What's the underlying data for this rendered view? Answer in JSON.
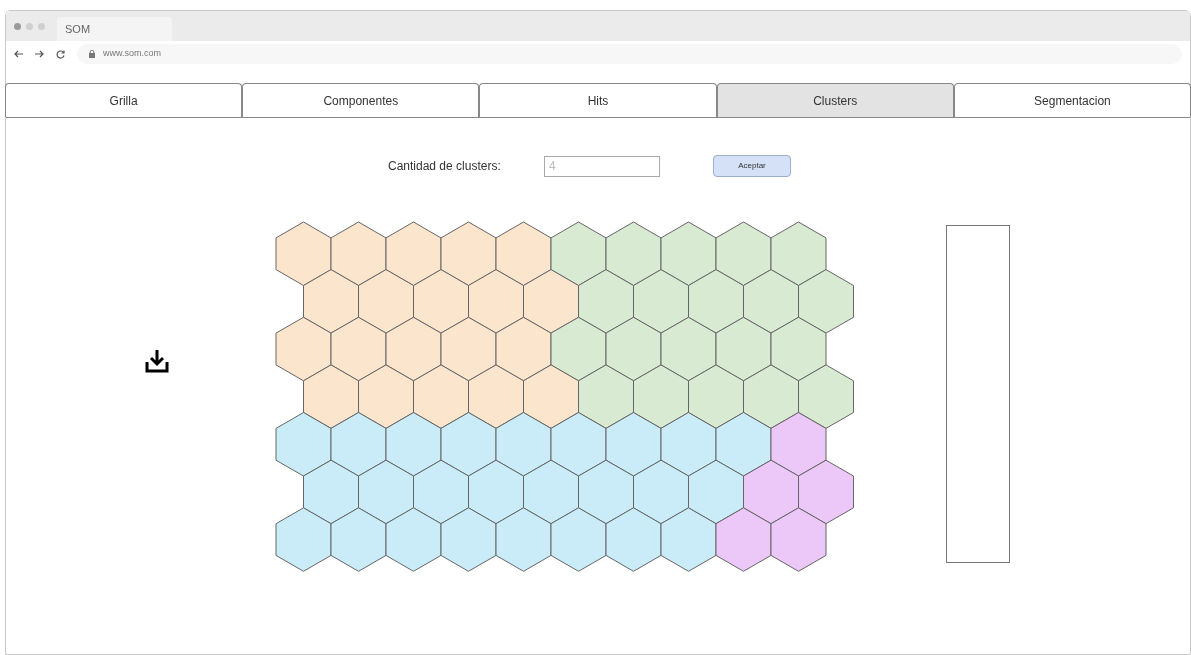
{
  "browser": {
    "tab_title": "SOM",
    "url": "www.som.com"
  },
  "tabs": [
    {
      "label": "Grilla",
      "selected": false
    },
    {
      "label": "Componentes",
      "selected": false
    },
    {
      "label": "Hits",
      "selected": false
    },
    {
      "label": "Clusters",
      "selected": true
    },
    {
      "label": "Segmentacion",
      "selected": false
    }
  ],
  "controls": {
    "label": "Cantidad de clusters:",
    "input": {
      "placeholder": "4"
    },
    "button": "Aceptar"
  },
  "grid": {
    "rows": [
      {
        "cells": [
          {
            "color": "#fce5cd"
          },
          {
            "color": "#fce5cd"
          },
          {
            "color": "#fce5cd"
          },
          {
            "color": "#fce5cd"
          },
          {
            "color": "#fce5cd"
          },
          {
            "color": "#d9ead3"
          },
          {
            "color": "#d9ead3"
          },
          {
            "color": "#d9ead3"
          },
          {
            "color": "#d9ead3"
          },
          {
            "color": "#d9ead3"
          }
        ]
      },
      {
        "cells": [
          {
            "color": "#fce5cd"
          },
          {
            "color": "#fce5cd"
          },
          {
            "color": "#fce5cd"
          },
          {
            "color": "#fce5cd"
          },
          {
            "color": "#fce5cd"
          },
          {
            "color": "#d9ead3"
          },
          {
            "color": "#d9ead3"
          },
          {
            "color": "#d9ead3"
          },
          {
            "color": "#d9ead3"
          },
          {
            "color": "#d9ead3"
          }
        ]
      },
      {
        "cells": [
          {
            "color": "#fce5cd"
          },
          {
            "color": "#fce5cd"
          },
          {
            "color": "#fce5cd"
          },
          {
            "color": "#fce5cd"
          },
          {
            "color": "#fce5cd"
          },
          {
            "color": "#d9ead3"
          },
          {
            "color": "#d9ead3"
          },
          {
            "color": "#d9ead3"
          },
          {
            "color": "#d9ead3"
          },
          {
            "color": "#d9ead3"
          }
        ]
      },
      {
        "cells": [
          {
            "color": "#fce5cd"
          },
          {
            "color": "#fce5cd"
          },
          {
            "color": "#fce5cd"
          },
          {
            "color": "#fce5cd"
          },
          {
            "color": "#fce5cd"
          },
          {
            "color": "#d9ead3"
          },
          {
            "color": "#d9ead3"
          },
          {
            "color": "#d9ead3"
          },
          {
            "color": "#d9ead3"
          },
          {
            "color": "#d9ead3"
          }
        ]
      },
      {
        "cells": [
          {
            "color": "#c9ecf8"
          },
          {
            "color": "#c9ecf8"
          },
          {
            "color": "#c9ecf8"
          },
          {
            "color": "#c9ecf8"
          },
          {
            "color": "#c9ecf8"
          },
          {
            "color": "#c9ecf8"
          },
          {
            "color": "#c9ecf8"
          },
          {
            "color": "#c9ecf8"
          },
          {
            "color": "#c9ecf8"
          },
          {
            "color": "#ebc8f7"
          }
        ]
      },
      {
        "cells": [
          {
            "color": "#c9ecf8"
          },
          {
            "color": "#c9ecf8"
          },
          {
            "color": "#c9ecf8"
          },
          {
            "color": "#c9ecf8"
          },
          {
            "color": "#c9ecf8"
          },
          {
            "color": "#c9ecf8"
          },
          {
            "color": "#c9ecf8"
          },
          {
            "color": "#c9ecf8"
          },
          {
            "color": "#ebc8f7"
          },
          {
            "color": "#ebc8f7"
          }
        ]
      },
      {
        "cells": [
          {
            "color": "#c9ecf8"
          },
          {
            "color": "#c9ecf8"
          },
          {
            "color": "#c9ecf8"
          },
          {
            "color": "#c9ecf8"
          },
          {
            "color": "#c9ecf8"
          },
          {
            "color": "#c9ecf8"
          },
          {
            "color": "#c9ecf8"
          },
          {
            "color": "#c9ecf8"
          },
          {
            "color": "#ebc8f7"
          },
          {
            "color": "#ebc8f7"
          }
        ]
      }
    ]
  }
}
